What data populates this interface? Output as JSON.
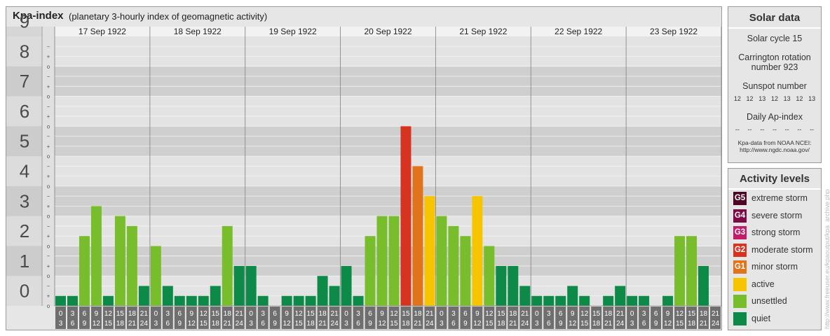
{
  "header": {
    "title": "Kpa-index",
    "subtitle": "(planetary 3-hourly index of geomagnetic activity)"
  },
  "chart_data": {
    "type": "bar",
    "title": "Kpa-index",
    "subtitle": "(planetary 3-hourly index of geomagnetic activity)",
    "ylim": [
      0,
      9
    ],
    "y_ticks": [
      "0",
      "1",
      "2",
      "3",
      "4",
      "5",
      "6",
      "7",
      "8",
      "9"
    ],
    "y_minor_marks": [
      "o",
      "+",
      "−"
    ],
    "days": [
      "17 Sep 1922",
      "18 Sep 1922",
      "19 Sep 1922",
      "20 Sep 1922",
      "21 Sep 1922",
      "22 Sep 1922",
      "23 Sep 1922"
    ],
    "interval_labels": [
      [
        "0",
        "3"
      ],
      [
        "3",
        "6"
      ],
      [
        "6",
        "9"
      ],
      [
        "9",
        "12"
      ],
      [
        "12",
        "15"
      ],
      [
        "15",
        "18"
      ],
      [
        "18",
        "21"
      ],
      [
        "21",
        "24"
      ]
    ],
    "values": [
      [
        0.333,
        0.333,
        2.333,
        3.333,
        0.333,
        3.0,
        2.667,
        0.667
      ],
      [
        2.0,
        0.667,
        0.333,
        0.333,
        0.333,
        0.667,
        2.667,
        1.333
      ],
      [
        1.333,
        0.333,
        0.0,
        0.333,
        0.333,
        0.333,
        1.0,
        0.667
      ],
      [
        1.333,
        0.333,
        2.333,
        3.0,
        3.0,
        6.0,
        4.667,
        3.667
      ],
      [
        3.0,
        2.667,
        2.333,
        3.667,
        2.0,
        1.333,
        1.333,
        0.667
      ],
      [
        0.333,
        0.333,
        0.333,
        0.667,
        0.333,
        0.0,
        0.333,
        0.667
      ],
      [
        0.333,
        0.333,
        0.0,
        0.333,
        2.333,
        2.333,
        1.333,
        0.0
      ]
    ],
    "colors": {
      "quiet": "#0d8a48",
      "unsettled": "#78bd2c",
      "active": "#f7c400",
      "minor_storm": "#e1731c",
      "moderate_storm": "#d63420",
      "strong_storm": "#c11c6a",
      "severe_storm": "#7f0b46",
      "extreme_storm": "#4d0625"
    },
    "legend_position": "right",
    "grid": true
  },
  "solar": {
    "title": "Solar data",
    "cycle": "Solar cycle 15",
    "carrington_line1": "Carrington rotation",
    "carrington_line2": "number 923",
    "sunspot_title": "Sunspot number",
    "sunspot_values": [
      "12",
      "12",
      "13",
      "12",
      "13",
      "12",
      "13"
    ],
    "ap_title": "Daily Ap-index",
    "ap_values": [
      "--",
      "--",
      "--",
      "--",
      "--",
      "--",
      "--"
    ],
    "source_line1": "Kpa-data from NOAA NCEI:",
    "source_line2": "http://www.ngdc.noaa.gov/"
  },
  "activity": {
    "title": "Activity levels",
    "items": [
      {
        "badge": "G5",
        "label": "extreme storm",
        "color": "#4d0625"
      },
      {
        "badge": "G4",
        "label": "severe storm",
        "color": "#7f0b46"
      },
      {
        "badge": "G3",
        "label": "strong storm",
        "color": "#c11c6a"
      },
      {
        "badge": "G2",
        "label": "moderate storm",
        "color": "#d63420"
      },
      {
        "badge": "G1",
        "label": "minor storm",
        "color": "#e1731c"
      },
      {
        "badge": "",
        "label": "active",
        "color": "#f7c400"
      },
      {
        "badge": "",
        "label": "unsettled",
        "color": "#78bd2c"
      },
      {
        "badge": "",
        "label": "quiet",
        "color": "#0d8a48"
      }
    ]
  },
  "watermark": "http://www.freeuser.eu/kpaoutput/kpa_archive.php"
}
